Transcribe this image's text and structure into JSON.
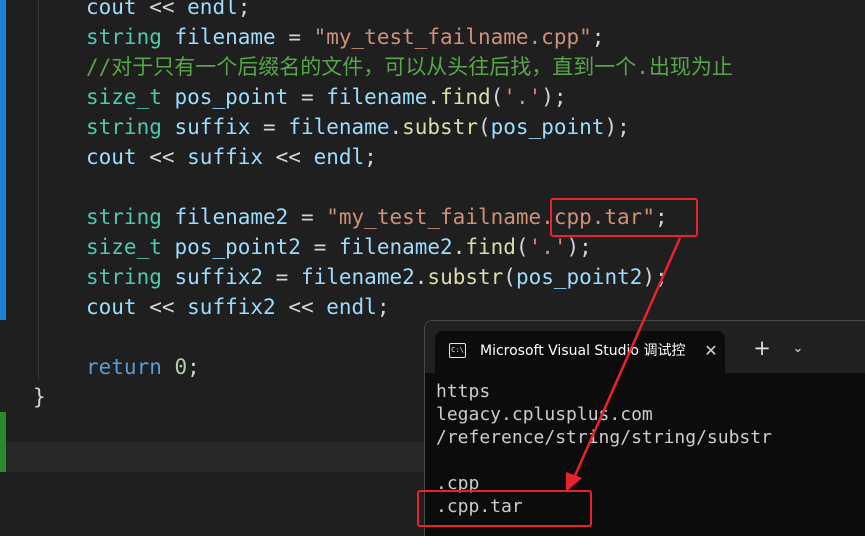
{
  "editor": {
    "lines": [
      {
        "tokens": [
          {
            "t": "cout",
            "c": "id"
          },
          {
            "t": " << ",
            "c": "op"
          },
          {
            "t": "endl",
            "c": "id"
          },
          {
            "t": ";",
            "c": "op"
          }
        ]
      },
      {
        "tokens": [
          {
            "t": "string",
            "c": "ty"
          },
          {
            "t": " ",
            "c": "op"
          },
          {
            "t": "filename",
            "c": "id"
          },
          {
            "t": " = ",
            "c": "op"
          },
          {
            "t": "\"my_test_failname.cpp\"",
            "c": "st"
          },
          {
            "t": ";",
            "c": "op"
          }
        ]
      },
      {
        "tokens": [
          {
            "t": "//对于只有一个后缀名的文件，可以从头往后找，直到一个.出现为止",
            "c": "cm"
          }
        ]
      },
      {
        "tokens": [
          {
            "t": "size_t",
            "c": "ty"
          },
          {
            "t": " ",
            "c": "op"
          },
          {
            "t": "pos_point",
            "c": "id"
          },
          {
            "t": " = ",
            "c": "op"
          },
          {
            "t": "filename",
            "c": "id"
          },
          {
            "t": ".",
            "c": "op"
          },
          {
            "t": "find",
            "c": "fn"
          },
          {
            "t": "(",
            "c": "op"
          },
          {
            "t": "'.'",
            "c": "st"
          },
          {
            "t": ");",
            "c": "op"
          }
        ]
      },
      {
        "tokens": [
          {
            "t": "string",
            "c": "ty"
          },
          {
            "t": " ",
            "c": "op"
          },
          {
            "t": "suffix",
            "c": "id"
          },
          {
            "t": " = ",
            "c": "op"
          },
          {
            "t": "filename",
            "c": "id"
          },
          {
            "t": ".",
            "c": "op"
          },
          {
            "t": "substr",
            "c": "fn"
          },
          {
            "t": "(",
            "c": "op"
          },
          {
            "t": "pos_point",
            "c": "id"
          },
          {
            "t": ");",
            "c": "op"
          }
        ]
      },
      {
        "tokens": [
          {
            "t": "cout",
            "c": "id"
          },
          {
            "t": " << ",
            "c": "op"
          },
          {
            "t": "suffix",
            "c": "id"
          },
          {
            "t": " << ",
            "c": "op"
          },
          {
            "t": "endl",
            "c": "id"
          },
          {
            "t": ";",
            "c": "op"
          }
        ]
      },
      {
        "tokens": []
      },
      {
        "tokens": [
          {
            "t": "string",
            "c": "ty"
          },
          {
            "t": " ",
            "c": "op"
          },
          {
            "t": "filename2",
            "c": "id"
          },
          {
            "t": " = ",
            "c": "op"
          },
          {
            "t": "\"my_test_failname.cpp.tar\"",
            "c": "st"
          },
          {
            "t": ";",
            "c": "op"
          }
        ]
      },
      {
        "tokens": [
          {
            "t": "size_t",
            "c": "ty"
          },
          {
            "t": " ",
            "c": "op"
          },
          {
            "t": "pos_point2",
            "c": "id"
          },
          {
            "t": " = ",
            "c": "op"
          },
          {
            "t": "filename2",
            "c": "id"
          },
          {
            "t": ".",
            "c": "op"
          },
          {
            "t": "find",
            "c": "fn"
          },
          {
            "t": "(",
            "c": "op"
          },
          {
            "t": "'.'",
            "c": "st"
          },
          {
            "t": ");",
            "c": "op"
          }
        ]
      },
      {
        "tokens": [
          {
            "t": "string",
            "c": "ty"
          },
          {
            "t": " ",
            "c": "op"
          },
          {
            "t": "suffix2",
            "c": "id"
          },
          {
            "t": " = ",
            "c": "op"
          },
          {
            "t": "filename2",
            "c": "id"
          },
          {
            "t": ".",
            "c": "op"
          },
          {
            "t": "substr",
            "c": "fn"
          },
          {
            "t": "(",
            "c": "op"
          },
          {
            "t": "pos_point2",
            "c": "id"
          },
          {
            "t": ");",
            "c": "op"
          }
        ]
      },
      {
        "tokens": [
          {
            "t": "cout",
            "c": "id"
          },
          {
            "t": " << ",
            "c": "op"
          },
          {
            "t": "suffix2",
            "c": "id"
          },
          {
            "t": " << ",
            "c": "op"
          },
          {
            "t": "endl",
            "c": "id"
          },
          {
            "t": ";",
            "c": "op"
          }
        ]
      },
      {
        "tokens": []
      },
      {
        "tokens": [
          {
            "t": "return",
            "c": "kw"
          },
          {
            "t": " ",
            "c": "op"
          },
          {
            "t": "0",
            "c": "nu"
          },
          {
            "t": ";",
            "c": "op"
          }
        ]
      },
      {
        "tokens": [
          {
            "t": "}",
            "c": "op"
          }
        ]
      }
    ]
  },
  "terminal": {
    "tab_title": "Microsoft Visual Studio 调试控",
    "tab_icon_text": "C:\\",
    "close_glyph": "✕",
    "new_tab_glyph": "+",
    "dropdown_glyph": "⌄",
    "output": [
      "https",
      "legacy.cplusplus.com",
      "/reference/string/string/substr",
      "",
      ".cpp",
      ".cpp.tar"
    ]
  },
  "colors": {
    "editor_bg": "#1f1f1f",
    "terminal_bg": "#0c0c0c",
    "annotation": "#e8232c",
    "modified_bar": "#1b81d8",
    "added_bar": "#2a8b2a"
  }
}
